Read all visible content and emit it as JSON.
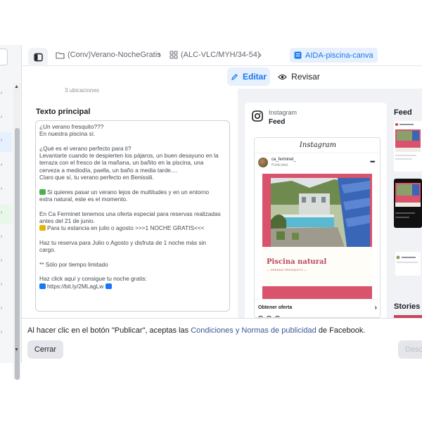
{
  "header": {
    "panel_toggle_icon": "sidebar-panel-icon",
    "breadcrumb": [
      {
        "icon": "folder-icon",
        "label": "(Conv)Verano-NocheGratis"
      },
      {
        "icon": "grid-icon",
        "label": "(ALC-VLC/MYH/34-54)"
      },
      {
        "icon": "ad-icon",
        "label": "AIDA-piscina-canva"
      }
    ]
  },
  "toolbar": {
    "edit_label": "Editar",
    "review_label": "Revisar"
  },
  "form": {
    "locations_text": "3 ubicaciones",
    "primary_text_label": "Texto principal",
    "primary_text_lines": [
      "¿Un verano fresquito???",
      "En nuestra piscina sí.",
      "",
      "¿Qué es el verano perfecto para ti?",
      "Levantarte cuando te despierten los pájaros, un buen desayuno en la",
      "terraza con el fresco de la mañana, un bañito en la piscina, una",
      "cerveza a mediodía, paella, un baño a media tarde....",
      "Claro que sí, tu verano perfecto en Benissili.",
      "",
      "Si quieres pasar un verano lejos de multitudes y en un entorno",
      "extra natural, este es el momento.",
      "",
      "En Ca Ferminet tenemos una oferta especial para reservas realizadas",
      "antes del 21 de junio.",
      "Para tu estancia en julio o agosto >>>1 NOCHE GRATIS<<<",
      "",
      "Haz tu reserva para Julio o Agosto y disfruta de 1 noche más sin",
      "cargo.",
      "",
      "** Sólo por tiempo limitado",
      "",
      "Haz click aquí y consigue tu noche gratis:",
      "https://bit.ly/2MLagLw"
    ]
  },
  "preview": {
    "platform": "Instagram",
    "placement": "Feed",
    "wordmark": "Instagram",
    "account": "ca_ferminet_",
    "sponsored": "Publicidad",
    "post_title": "Piscina natural",
    "post_subtitle": "— VERANO FRESQUITO —",
    "cta": "Obtener oferta"
  },
  "side_placements": {
    "feed_label": "Feed",
    "stories_label": "Stories"
  },
  "footer": {
    "terms_prefix": "Al hacer clic en el botón \"Publicar\", aceptas las ",
    "terms_link": "Condiciones y Normas de publicidad",
    "terms_suffix": " de Facebook.",
    "close_label": "Cerrar",
    "discard_label": "Desc"
  },
  "colors": {
    "accent": "#1877f2",
    "post_background": "#d9536c",
    "link": "#385898"
  }
}
